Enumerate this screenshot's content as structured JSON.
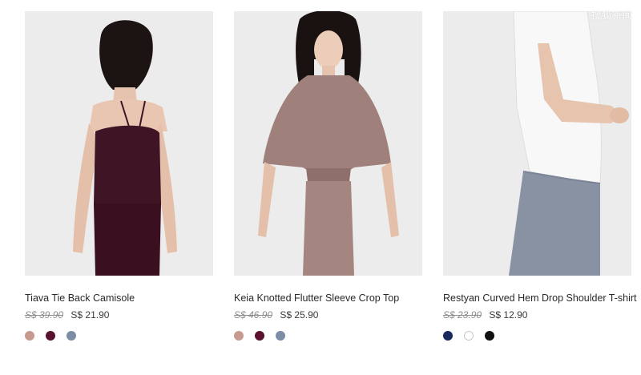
{
  "watermark": "搜狐新闻",
  "products": [
    {
      "name": "Tiava Tie Back Camisole",
      "original_price": "S$ 39.90",
      "sale_price": "S$ 21.90",
      "swatches": [
        {
          "color": "#c79a8f",
          "outline": false
        },
        {
          "color": "#5a1230",
          "outline": false
        },
        {
          "color": "#7c8ea6",
          "outline": false
        }
      ]
    },
    {
      "name": "Keia Knotted Flutter Sleeve Crop Top",
      "original_price": "S$ 46.90",
      "sale_price": "S$ 25.90",
      "swatches": [
        {
          "color": "#c79a8f",
          "outline": false
        },
        {
          "color": "#5a1230",
          "outline": false
        },
        {
          "color": "#7c8ea6",
          "outline": false
        }
      ]
    },
    {
      "name": "Restyan Curved Hem Drop Shoulder T-shirt",
      "original_price": "S$ 23.90",
      "sale_price": "S$ 12.90",
      "swatches": [
        {
          "color": "#1b2a5e",
          "outline": false
        },
        {
          "color": "#ffffff",
          "outline": true
        },
        {
          "color": "#111111",
          "outline": false
        }
      ]
    }
  ]
}
